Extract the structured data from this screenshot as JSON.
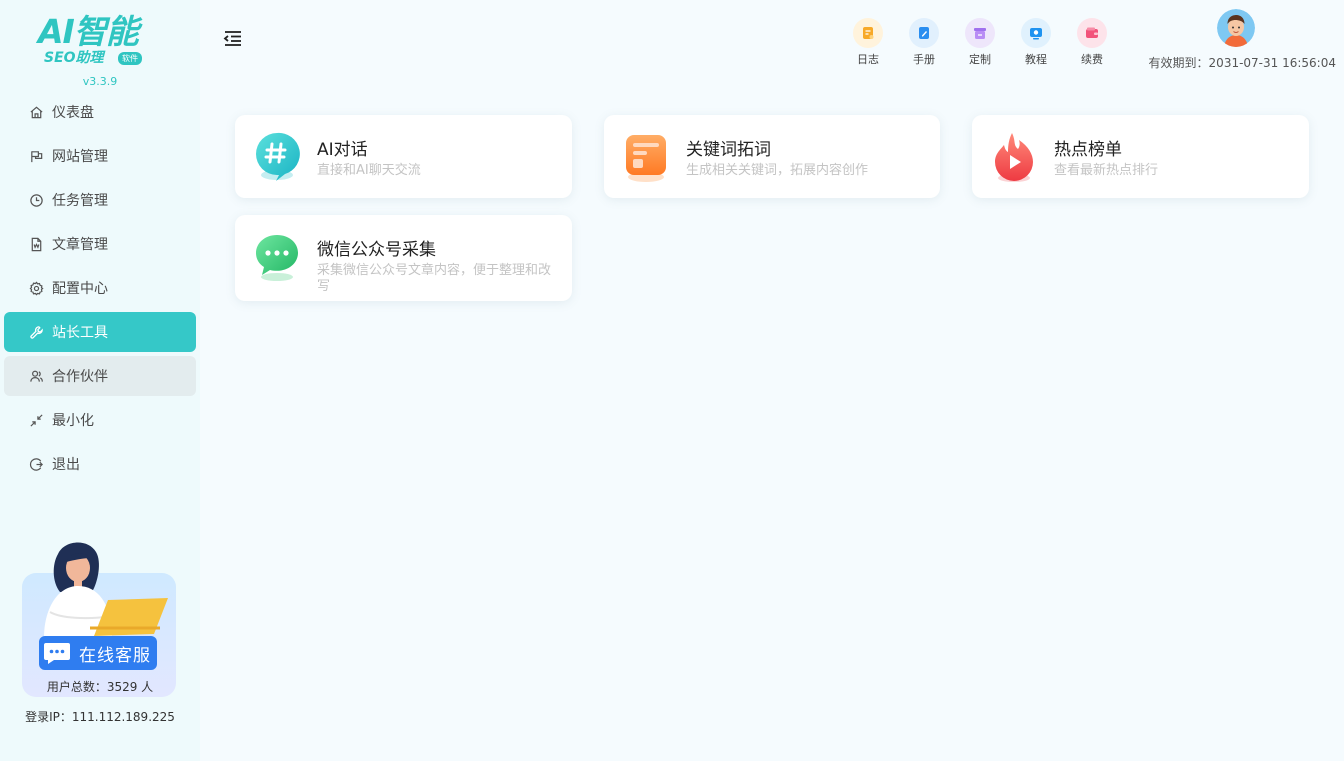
{
  "app": {
    "logo_main": "AI智能",
    "logo_sub": "SEO助理",
    "logo_tag": "软件",
    "version": "v3.3.9"
  },
  "sidebar": {
    "items": [
      {
        "label": "仪表盘",
        "icon": "home-icon"
      },
      {
        "label": "网站管理",
        "icon": "flag-icon"
      },
      {
        "label": "任务管理",
        "icon": "clock-icon"
      },
      {
        "label": "文章管理",
        "icon": "document-icon"
      },
      {
        "label": "配置中心",
        "icon": "gear-icon"
      },
      {
        "label": "站长工具",
        "icon": "wrench-icon",
        "active": true
      },
      {
        "label": "合作伙伴",
        "icon": "users-icon",
        "hover": true
      },
      {
        "label": "最小化",
        "icon": "minimize-icon"
      },
      {
        "label": "退出",
        "icon": "logout-icon"
      }
    ],
    "support_label": "在线客服",
    "user_count": "用户总数：3529 人",
    "login_ip": "登录IP：111.112.189.225"
  },
  "header": {
    "quick_links": [
      {
        "label": "日志",
        "icon": "log-icon",
        "color": "#f7a928",
        "bg": "#fff3dc"
      },
      {
        "label": "手册",
        "icon": "manual-icon",
        "color": "#2a8ef0",
        "bg": "#e1f0fd"
      },
      {
        "label": "定制",
        "icon": "custom-icon",
        "color": "#a070ee",
        "bg": "#eee6fb"
      },
      {
        "label": "教程",
        "icon": "tutorial-icon",
        "color": "#1f93f0",
        "bg": "#e0f1fd"
      },
      {
        "label": "续费",
        "icon": "renew-icon",
        "color": "#f2527a",
        "bg": "#fde3ea"
      }
    ],
    "expiry": "有效期到：2031-07-31 16:56:04"
  },
  "tools": [
    {
      "title": "AI对话",
      "desc": "直接和AI聊天交流",
      "icon": "hashtag-chat-icon",
      "color": "#28c3c8"
    },
    {
      "title": "关键词拓词",
      "desc": "生成相关关键词，拓展内容创作",
      "icon": "keyword-card-icon",
      "color": "#ff8a3d"
    },
    {
      "title": "热点榜单",
      "desc": "查看最新热点排行",
      "icon": "hot-flame-icon",
      "color": "#f2454c"
    },
    {
      "title": "微信公众号采集",
      "desc": "采集微信公众号文章内容，便于整理和改写",
      "icon": "wechat-bubble-icon",
      "color": "#3cc775"
    }
  ]
}
